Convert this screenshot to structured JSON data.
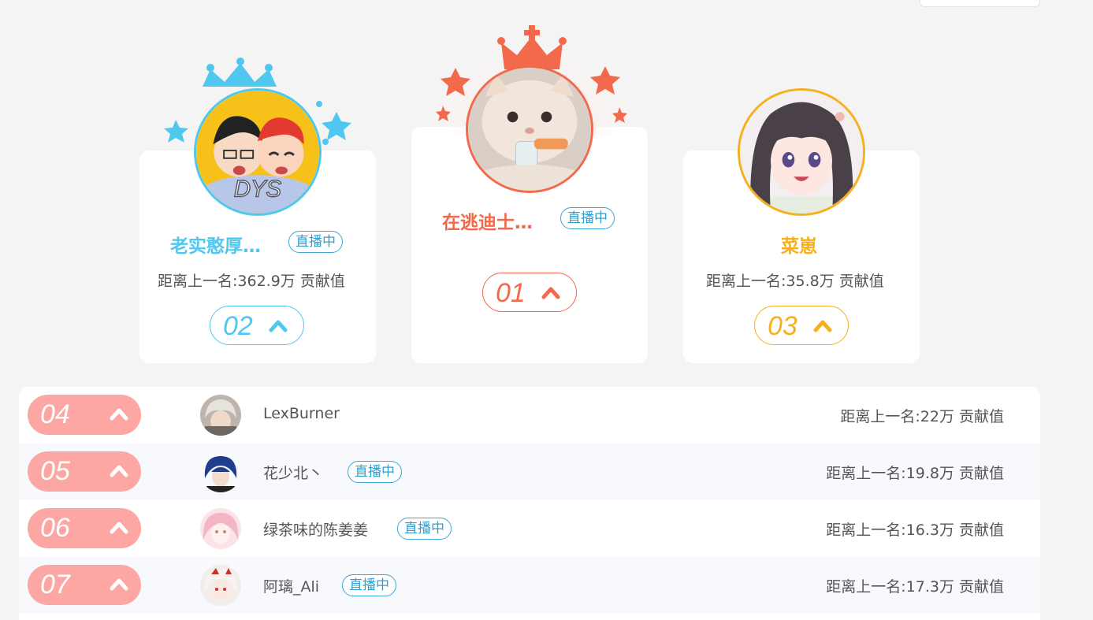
{
  "colors": {
    "rank1": "#f26a4b",
    "rank2": "#4fc7ef",
    "rank3": "#f6b01e",
    "rest_pill": "#fda7a4",
    "live": "#2f9fd2"
  },
  "podium": [
    {
      "rank": "02",
      "name": "老实憨厚…",
      "live": "直播中",
      "gap": "距离上一名:362.9万 贡献值",
      "avatar_icon": "cartoon-duo-avatar",
      "crown_icon": "blue-crown-icon"
    },
    {
      "rank": "01",
      "name": "在逃迪士…",
      "live": "直播中",
      "gap": "",
      "avatar_icon": "cat-avatar",
      "crown_icon": "red-crown-icon"
    },
    {
      "rank": "03",
      "name": "菜崽",
      "live": "",
      "gap": "距离上一名:35.8万 贡献值",
      "avatar_icon": "anime-girl-avatar",
      "crown_icon": ""
    }
  ],
  "list": [
    {
      "rank": "04",
      "name": "LexBurner",
      "live": "",
      "gap": "距离上一名:22万 贡献值"
    },
    {
      "rank": "05",
      "name": "花少北丶",
      "live": "直播中",
      "gap": "距离上一名:19.8万 贡献值"
    },
    {
      "rank": "06",
      "name": "绿茶味的陈姜姜",
      "live": "直播中",
      "gap": "距离上一名:16.3万 贡献值"
    },
    {
      "rank": "07",
      "name": "阿璃_Ali",
      "live": "直播中",
      "gap": "距离上一名:17.3万 贡献值"
    }
  ]
}
